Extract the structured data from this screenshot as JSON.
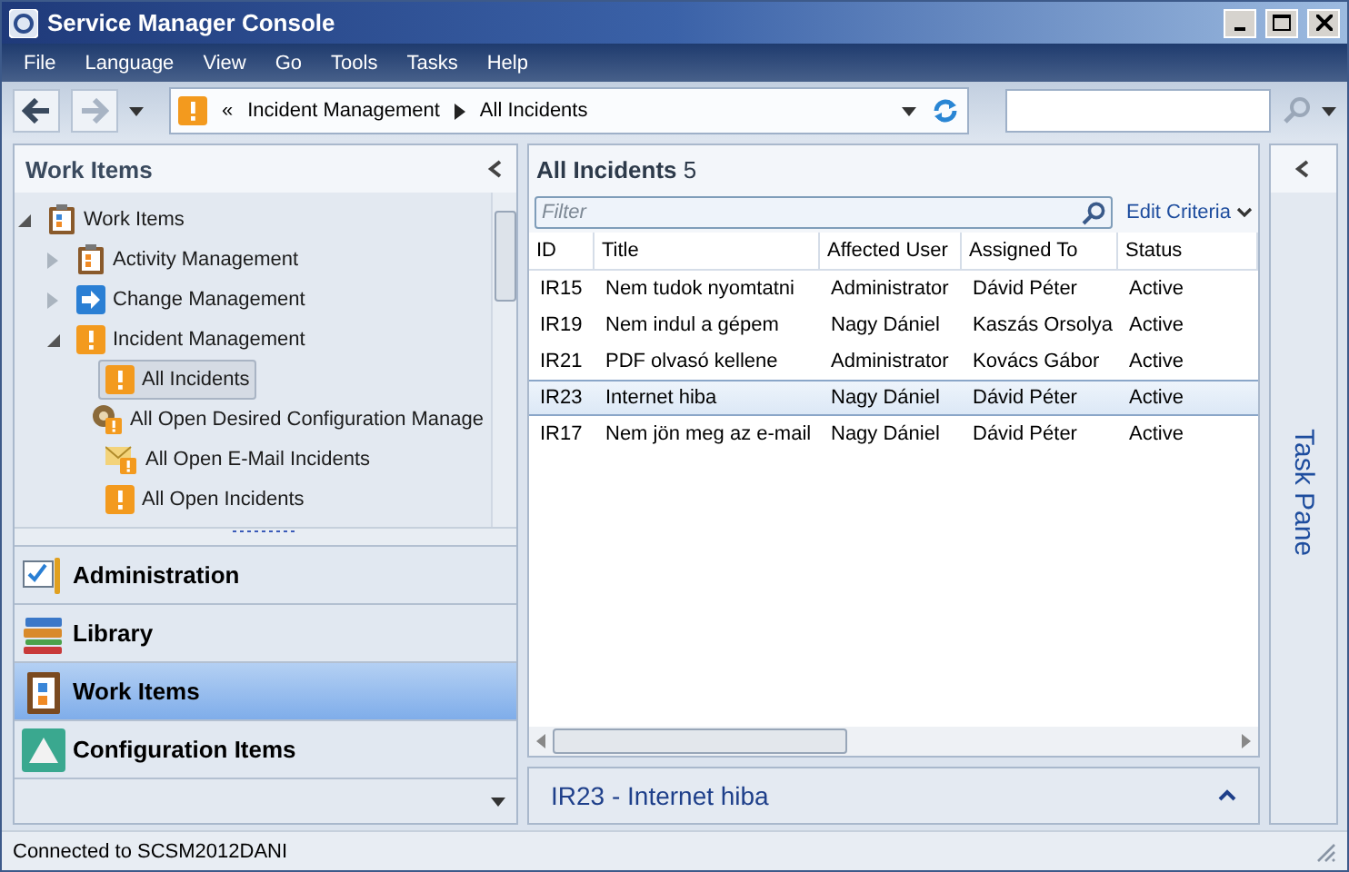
{
  "window": {
    "title": "Service Manager Console"
  },
  "menu": [
    "File",
    "Language",
    "View",
    "Go",
    "Tools",
    "Tasks",
    "Help"
  ],
  "breadcrumb": {
    "overflow": "«",
    "items": [
      "Incident Management",
      "All Incidents"
    ]
  },
  "left_panel": {
    "title": "Work Items",
    "tree": [
      {
        "label": "Work Items",
        "kind": "clipboard",
        "expanded": true,
        "selected": false,
        "children": [
          {
            "label": "Activity Management",
            "kind": "activity",
            "expanded": false,
            "selected": false
          },
          {
            "label": "Change Management",
            "kind": "change",
            "expanded": false,
            "selected": false
          },
          {
            "label": "Incident Management",
            "kind": "incident",
            "expanded": true,
            "selected": false,
            "children": [
              {
                "label": "All Incidents",
                "kind": "incident",
                "selected": true
              },
              {
                "label": "All Open Desired Configuration Manage",
                "kind": "dcm",
                "selected": false
              },
              {
                "label": "All Open E-Mail Incidents",
                "kind": "email",
                "selected": false
              },
              {
                "label": "All Open Incidents",
                "kind": "incident",
                "selected": false
              }
            ]
          }
        ]
      }
    ]
  },
  "workspaces": [
    {
      "label": "Administration",
      "kind": "admin",
      "selected": false
    },
    {
      "label": "Library",
      "kind": "library",
      "selected": false
    },
    {
      "label": "Work Items",
      "kind": "workitems",
      "selected": true
    },
    {
      "label": "Configuration Items",
      "kind": "config",
      "selected": false
    }
  ],
  "list": {
    "title": "All Incidents",
    "count": "5",
    "filter": {
      "placeholder": "Filter"
    },
    "edit_criteria": "Edit Criteria",
    "columns": [
      "ID",
      "Title",
      "Affected User",
      "Assigned To",
      "Status"
    ],
    "rows": [
      {
        "cells": [
          "IR15",
          "Nem tudok nyomtatni",
          "Administrator",
          "Dávid Péter",
          "Active"
        ],
        "selected": false
      },
      {
        "cells": [
          "IR19",
          "Nem indul a gépem",
          "Nagy Dániel",
          "Kaszás Orsolya",
          "Active"
        ],
        "selected": false
      },
      {
        "cells": [
          "IR21",
          "PDF olvasó kellene",
          "Administrator",
          "Kovács Gábor",
          "Active"
        ],
        "selected": false
      },
      {
        "cells": [
          "IR23",
          "Internet hiba",
          "Nagy Dániel",
          "Dávid Péter",
          "Active"
        ],
        "selected": true
      },
      {
        "cells": [
          "IR17",
          "Nem jön meg az e-mail",
          "Nagy Dániel",
          "Dávid Péter",
          "Active"
        ],
        "selected": false
      }
    ]
  },
  "preview": {
    "title": "IR23 - Internet hiba"
  },
  "task_pane": {
    "title": "Task Pane"
  },
  "status_bar": "Connected to SCSM2012DANI"
}
